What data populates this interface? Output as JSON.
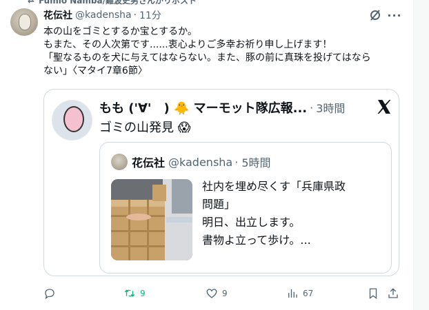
{
  "repost": {
    "icon": "repost-icon",
    "label": "Fumio Namba/難波史男さんがリポスト"
  },
  "tweet": {
    "author_name": "花伝社",
    "handle": "@kadensha",
    "dot": "·",
    "time": "11分",
    "lines": [
      "本の山をゴミとするか宝とするか。",
      "もまた、その人次第です......衷心よりご多幸お祈り申し上げます！",
      "「聖なるものを犬に与えてはならない。また、豚の前に真珠を投げてはなら",
      "ない」〈マタイ7章6節〉"
    ]
  },
  "quote": {
    "author_name": "もも ('∀'　) 🐥 マーモット隊広報...",
    "dot": "·",
    "time": "3時間",
    "text": "ゴミの山発見 😱",
    "inner": {
      "author_name": "花伝社",
      "handle": "@kadensha",
      "dot": "·",
      "time": "5時間",
      "lines": [
        "社内を埋め尽くす「兵庫県政",
        "問題」",
        "明日、出立します。",
        "書物よ立って歩け。..."
      ]
    }
  },
  "actions": {
    "reply_count": "",
    "retweet_count": "9",
    "like_count": "9",
    "views_count": "67"
  },
  "colors": {
    "text": "#0f1419",
    "muted": "#536471",
    "retweet_green": "#00ba7c",
    "border": "#cfd9de"
  }
}
